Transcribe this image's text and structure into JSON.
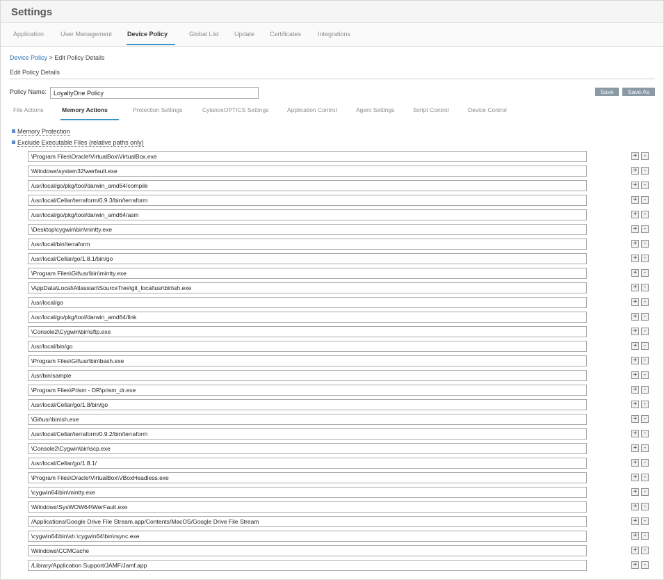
{
  "header": {
    "title": "Settings"
  },
  "top_tabs": [
    {
      "label": "Application",
      "active": false
    },
    {
      "label": "User Management",
      "active": false
    },
    {
      "label": "Device Policy",
      "active": true
    },
    {
      "label": "Global List",
      "active": false
    },
    {
      "label": "Update",
      "active": false
    },
    {
      "label": "Certificates",
      "active": false
    },
    {
      "label": "Integrations",
      "active": false
    }
  ],
  "breadcrumb": {
    "link": "Device Policy",
    "separator": ">",
    "current": "Edit Policy Details"
  },
  "section_title": "Edit Policy Details",
  "policy": {
    "label": "Policy Name:",
    "value": "LoyaltyOne Policy"
  },
  "buttons": {
    "save": "Save",
    "save_as": "Save As"
  },
  "sub_tabs": [
    {
      "label": "File Actions",
      "active": false
    },
    {
      "label": "Memory Actions",
      "active": true
    },
    {
      "label": "Protection Settings",
      "active": false
    },
    {
      "label": "CylanceOPTICS Settings",
      "active": false
    },
    {
      "label": "Application Control",
      "active": false
    },
    {
      "label": "Agent Settings",
      "active": false
    },
    {
      "label": "Script Control",
      "active": false
    },
    {
      "label": "Device Control",
      "active": false
    }
  ],
  "options": {
    "memory_protection": "Memory Protection",
    "exclude_files": "Exclude Executable Files (relative paths only)"
  },
  "row_buttons": {
    "plus": "+",
    "minus": "-"
  },
  "exclusions": [
    "\\Program Files\\Oracle\\VirtualBox\\VirtualBox.exe",
    "\\Windows\\system32\\werfault.exe",
    "/usr/local/go/pkg/tool/darwin_amd64/compile",
    "/usr/local/Cellar/terraform/0.9.3/bin/terraform",
    "/usr/local/go/pkg/tool/darwin_amd64/asm",
    "\\Desktop\\cygwin\\bin\\mintty.exe",
    "/usr/local/bin/terraform",
    "/usr/local/Cellar/go/1.8.1/bin/go",
    "\\Program Files\\Git\\usr\\bin\\mintty.exe",
    "\\AppData\\Local\\Atlassian\\SourceTree\\git_local\\usr\\bin\\sh.exe",
    "/usr/local/go",
    "/usr/local/go/pkg/tool/darwin_amd64/link",
    "\\Console2\\Cygwin\\bin\\sftp.exe",
    "/usr/local/bin/go",
    "\\Program Files\\Git\\usr\\bin\\bash.exe",
    "/usr/bin/sample",
    "\\Program Files\\Prism - DR\\prism_dr.exe",
    "/usr/local/Cellar/go/1.8/bin/go",
    "\\Git\\usr\\bin\\sh.exe",
    "/usr/local/Cellar/terraform/0.9.2/bin/terraform",
    "\\Console2\\Cygwin\\bin\\scp.exe",
    "/usr/local/Cellar/go/1.8.1/",
    "\\Program Files\\Oracle\\VirtualBox\\VBoxHeadless.exe",
    "\\cygwin64\\bin\\mintty.exe",
    "\\Windows\\SysWOW64\\WerFault.exe",
    "/Applications/Google Drive File Stream.app/Contents/MacOS/Google Drive File Stream",
    "\\cygwin64\\bin\\sh.\\cygwin64\\bin\\rsync.exe",
    "\\Windows\\CCMCache",
    "/Library/Application Support/JAMF/Jamf.app"
  ]
}
